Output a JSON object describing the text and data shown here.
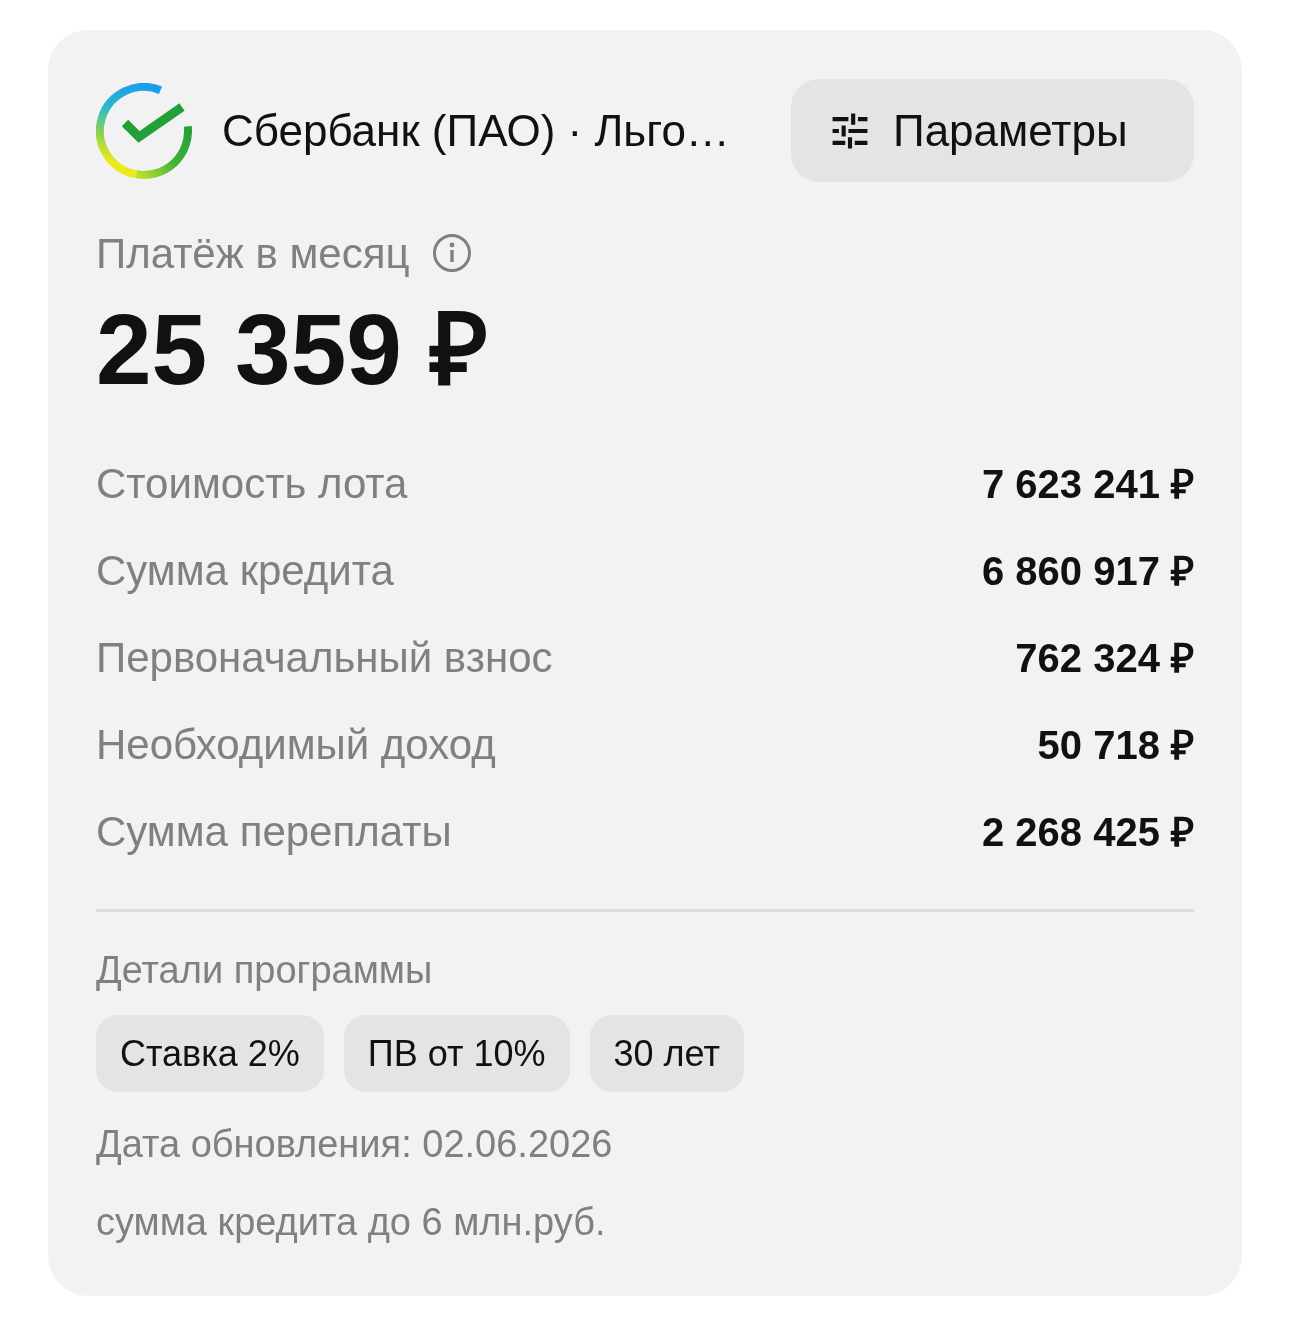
{
  "header": {
    "title": "Сбербанк (ПАО) · Льго…",
    "params_button": {
      "label": "Параметры"
    }
  },
  "payment": {
    "label": "Платёж в месяц",
    "amount": "25 359 ₽"
  },
  "rows": [
    {
      "label": "Стоимость лота",
      "value": "7 623 241 ₽"
    },
    {
      "label": "Сумма кредита",
      "value": "6 860 917 ₽"
    },
    {
      "label": "Первоначальный взнос",
      "value": "762 324 ₽"
    },
    {
      "label": "Необходимый доход",
      "value": "50 718 ₽"
    },
    {
      "label": "Сумма переплаты",
      "value": "2 268 425 ₽"
    }
  ],
  "program": {
    "title": "Детали программы",
    "tags": [
      "Ставка 2%",
      "ПВ от 10%",
      "30 лет"
    ],
    "updated": "Дата обновления: 02.06.2026",
    "note": "сумма кредита до 6 млн.руб."
  }
}
